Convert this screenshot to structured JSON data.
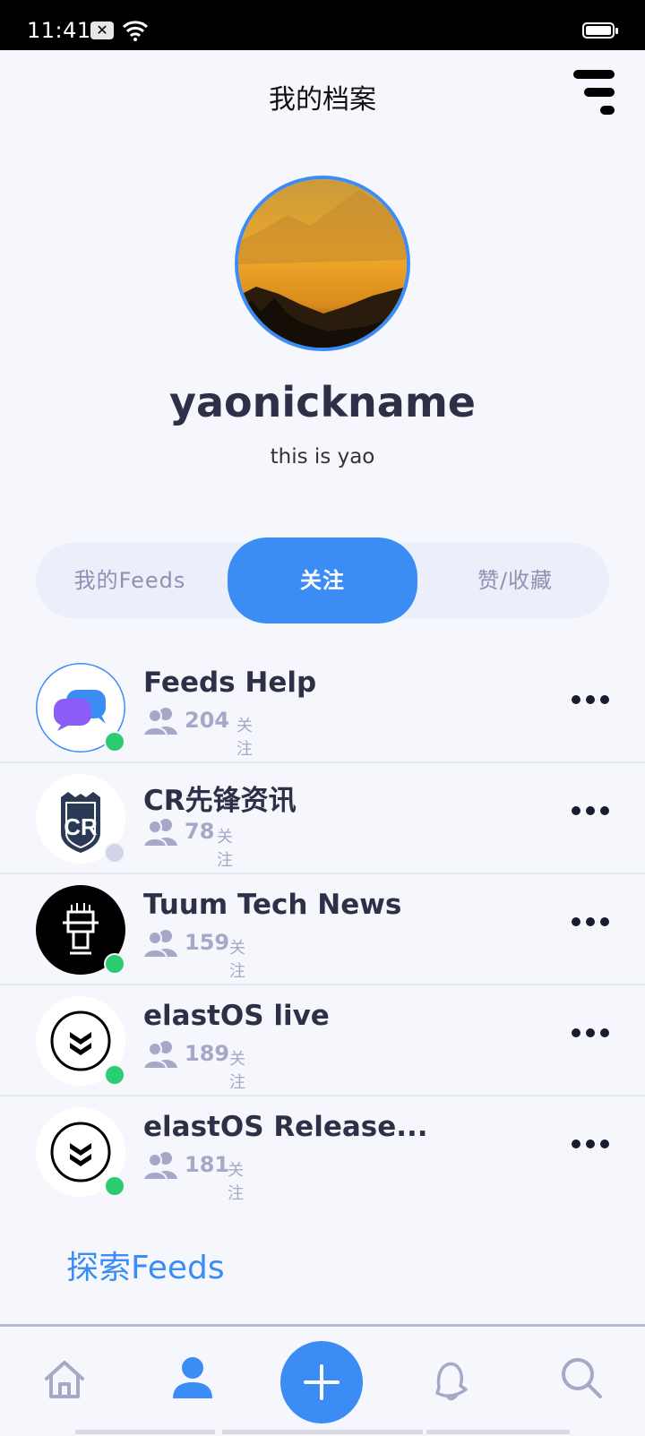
{
  "status_bar": {
    "time": "11:41"
  },
  "header": {
    "title": "我的档案"
  },
  "profile": {
    "username": "yaonickname",
    "bio": "this is yao"
  },
  "tabs": [
    {
      "label": "我的Feeds",
      "active": false
    },
    {
      "label": "关注",
      "active": true
    },
    {
      "label": "赞/收藏",
      "active": false
    }
  ],
  "feeds": [
    {
      "name": "Feeds Help",
      "count": "204",
      "label": "关注",
      "online": true
    },
    {
      "name": "CR先锋资讯",
      "count": "78",
      "label": "关注",
      "online": false
    },
    {
      "name": "Tuum Tech News",
      "count": "159",
      "label": "关注",
      "online": true
    },
    {
      "name": "elastOS live",
      "count": "189",
      "label": "关注",
      "online": true
    },
    {
      "name": "elastOS Release...",
      "count": "181",
      "label": "关注",
      "online": true
    }
  ],
  "explore_label": "探索Feeds",
  "bottom_nav": {
    "active": "profile"
  },
  "colors": {
    "accent": "#3b8cf5",
    "online": "#2ecc71",
    "offline": "#d3d4ea",
    "text_dark": "#2f3048",
    "muted": "#a6a8c7"
  }
}
